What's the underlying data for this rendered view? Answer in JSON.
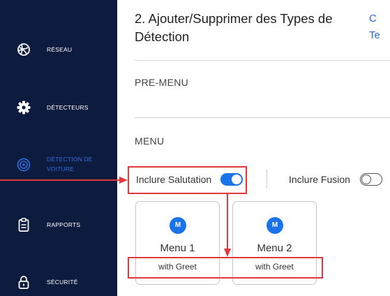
{
  "sidebar": {
    "items": [
      {
        "label": "RÉSEAU",
        "icon": "network-globe-icon",
        "active": false
      },
      {
        "label": "DÉTECTEURS",
        "icon": "gear-icon",
        "active": false
      },
      {
        "label_line1": "DÉTECTION DE",
        "label_line2": "VOITURE",
        "icon": "car-detection-icon",
        "active": true
      },
      {
        "label": "RAPPORTS",
        "icon": "clipboard-icon",
        "active": false
      },
      {
        "label": "SÉCURITÉ",
        "icon": "lock-icon",
        "active": false
      }
    ]
  },
  "main": {
    "title": "2. Ajouter/Supprimer des Types de Détection",
    "cut_link_line1": "C",
    "cut_link_line2": "Te",
    "pre_menu_label": "PRE-MENU",
    "menu_label": "MENU",
    "toggles": [
      {
        "label": "Inclure Salutation",
        "state": "on"
      },
      {
        "label": "Inclure Fusion",
        "state": "off"
      }
    ],
    "cards": [
      {
        "badge": "M",
        "title": "Menu 1",
        "subtitle": "with Greet"
      },
      {
        "badge": "M",
        "title": "Menu 2",
        "subtitle": "with Greet"
      }
    ]
  },
  "colors": {
    "sidebar_bg": "#0d1b3e",
    "accent": "#1a73e8",
    "annotation": "#e0383b"
  }
}
